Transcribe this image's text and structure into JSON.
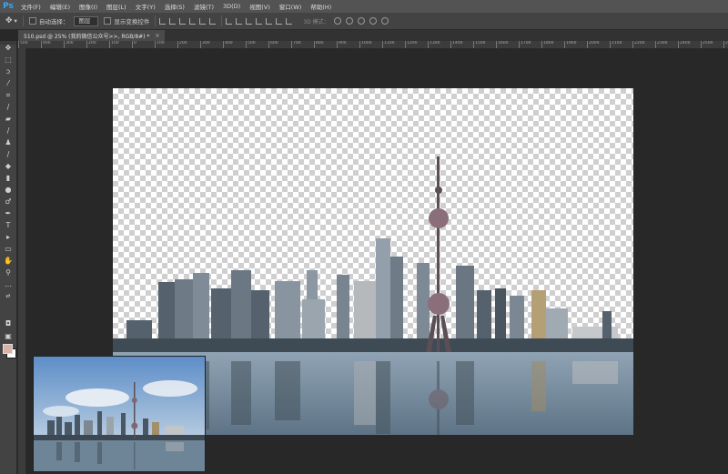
{
  "app": {
    "logo": "Ps"
  },
  "menu": [
    "文件(F)",
    "编辑(E)",
    "图像(I)",
    "图层(L)",
    "文字(Y)",
    "选择(S)",
    "滤镜(T)",
    "3D(D)",
    "视图(V)",
    "窗口(W)",
    "帮助(H)"
  ],
  "options": {
    "move_tool_icon": "move-icon",
    "auto_select_label": "自动选择：",
    "auto_select_value": "图层",
    "transform_controls_label": "显示变换控件",
    "mode_3d_label": "3D 模式："
  },
  "document": {
    "tab_title": "510.psd @ 25% (我的微信公众号>>, RGB/8#) *",
    "close_glyph": "×"
  },
  "ruler": {
    "ticks": [
      "500",
      "400",
      "300",
      "200",
      "100",
      "0",
      "100",
      "200",
      "300",
      "400",
      "500",
      "600",
      "700",
      "800",
      "900",
      "1000",
      "1100",
      "1200",
      "1300",
      "1400",
      "1500",
      "1600",
      "1700",
      "1800",
      "1900",
      "2000",
      "2100",
      "2200",
      "2300",
      "2400",
      "2500",
      "2600",
      "2700"
    ]
  },
  "tools": [
    "move-icon",
    "marquee-icon",
    "lasso-icon",
    "quick-select-icon",
    "crop-icon",
    "eyedropper-icon",
    "healing-brush-icon",
    "brush-icon",
    "clone-stamp-icon",
    "history-brush-icon",
    "eraser-icon",
    "gradient-icon",
    "blur-icon",
    "dodge-icon",
    "pen-icon",
    "type-icon",
    "path-select-icon",
    "rectangle-icon",
    "hand-icon",
    "zoom-icon",
    "more-icon"
  ],
  "colors": {
    "foreground": "#d9b3aa",
    "background": "#ffffff",
    "ps_accent": "#31a8ff"
  }
}
